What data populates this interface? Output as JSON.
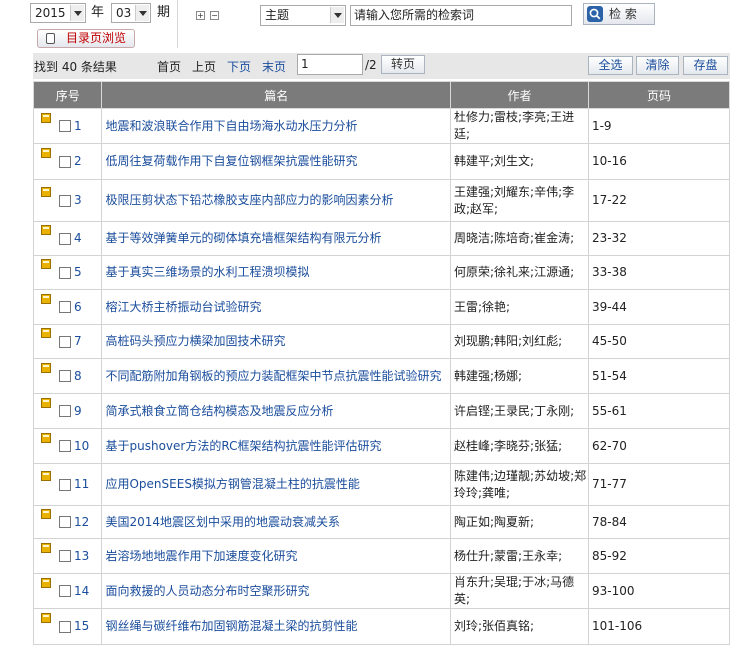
{
  "search": {
    "year_value": "2015",
    "year_label": "年",
    "issue_value": "03",
    "issue_label": "期",
    "expand_symbol": "⊞",
    "collapse_symbol": "⊟",
    "field_value": "主题",
    "keyword_placeholder": "请输入您所需的检索词",
    "search_label": "检 索"
  },
  "toc_button_label": "目录页浏览",
  "toolbar": {
    "result_count": "找到 40 条结果",
    "first_page": "首页",
    "prev_page": "上页",
    "next_page": "下页",
    "last_page": "末页",
    "page_input": "1",
    "page_total": "/2",
    "goto_label": "转页",
    "select_all": "全选",
    "clear": "清除",
    "save": "存盘"
  },
  "table": {
    "headers": [
      "序号",
      "篇名",
      "作者",
      "页码"
    ],
    "rows": [
      {
        "no": "1",
        "title": "地震和波浪联合作用下自由场海水动水压力分析",
        "authors": "杜修力;雷枝;李亮;王进廷;",
        "pages": "1-9"
      },
      {
        "no": "2",
        "title": "低周往复荷载作用下自复位钢框架抗震性能研究",
        "authors": "韩建平;刘生文;",
        "pages": "10-16"
      },
      {
        "no": "3",
        "title": "极限压剪状态下铅芯橡胶支座内部应力的影响因素分析",
        "authors": "王建强;刘耀东;辛伟;李政;赵军;",
        "pages": "17-22"
      },
      {
        "no": "4",
        "title": "基于等效弹簧单元的砌体填充墙框架结构有限元分析",
        "authors": "周晓洁;陈培奇;崔金涛;",
        "pages": "23-32"
      },
      {
        "no": "5",
        "title": "基于真实三维场景的水利工程溃坝模拟",
        "authors": "何原荣;徐礼来;江源通;",
        "pages": "33-38"
      },
      {
        "no": "6",
        "title": "榕江大桥主桥振动台试验研究",
        "authors": "王雷;徐艳;",
        "pages": "39-44"
      },
      {
        "no": "7",
        "title": "高桩码头预应力横梁加固技术研究",
        "authors": "刘现鹏;韩阳;刘红彪;",
        "pages": "45-50"
      },
      {
        "no": "8",
        "title": "不同配筋附加角钢板的预应力装配框架中节点抗震性能试验研究",
        "authors": "韩建强;杨娜;",
        "pages": "51-54"
      },
      {
        "no": "9",
        "title": "简承式粮食立筒仓结构模态及地震反应分析",
        "authors": "许启铿;王录民;丁永刚;",
        "pages": "55-61"
      },
      {
        "no": "10",
        "title": "基于pushover方法的RC框架结构抗震性能评估研究",
        "authors": "赵桂峰;李晓芬;张猛;",
        "pages": "62-70"
      },
      {
        "no": "11",
        "title": "应用OpenSEES模拟方钢管混凝土柱的抗震性能",
        "authors": "陈建伟;边瑾靓;苏幼坡;郑玲玲;龚唯;",
        "pages": "71-77"
      },
      {
        "no": "12",
        "title": "美国2014地震区划中采用的地震动衰减关系",
        "authors": "陶正如;陶夏新;",
        "pages": "78-84"
      },
      {
        "no": "13",
        "title": "岩溶场地地震作用下加速度变化研究",
        "authors": "杨仕升;蒙雷;王永幸;",
        "pages": "85-92"
      },
      {
        "no": "14",
        "title": "面向救援的人员动态分布时空聚形研究",
        "authors": "肖东升;吴琨;于冰;马德英;",
        "pages": "93-100"
      },
      {
        "no": "15",
        "title": "钢丝绳与碳纤维布加固钢筋混凝土梁的抗剪性能",
        "authors": "刘玲;张佰真铭;",
        "pages": "101-106"
      }
    ]
  },
  "colors": {
    "header_bg": "#7b7b7b",
    "link": "#1a4d9c",
    "toolbar_bg": "#e7e7e7",
    "toc_text": "#c00000"
  }
}
